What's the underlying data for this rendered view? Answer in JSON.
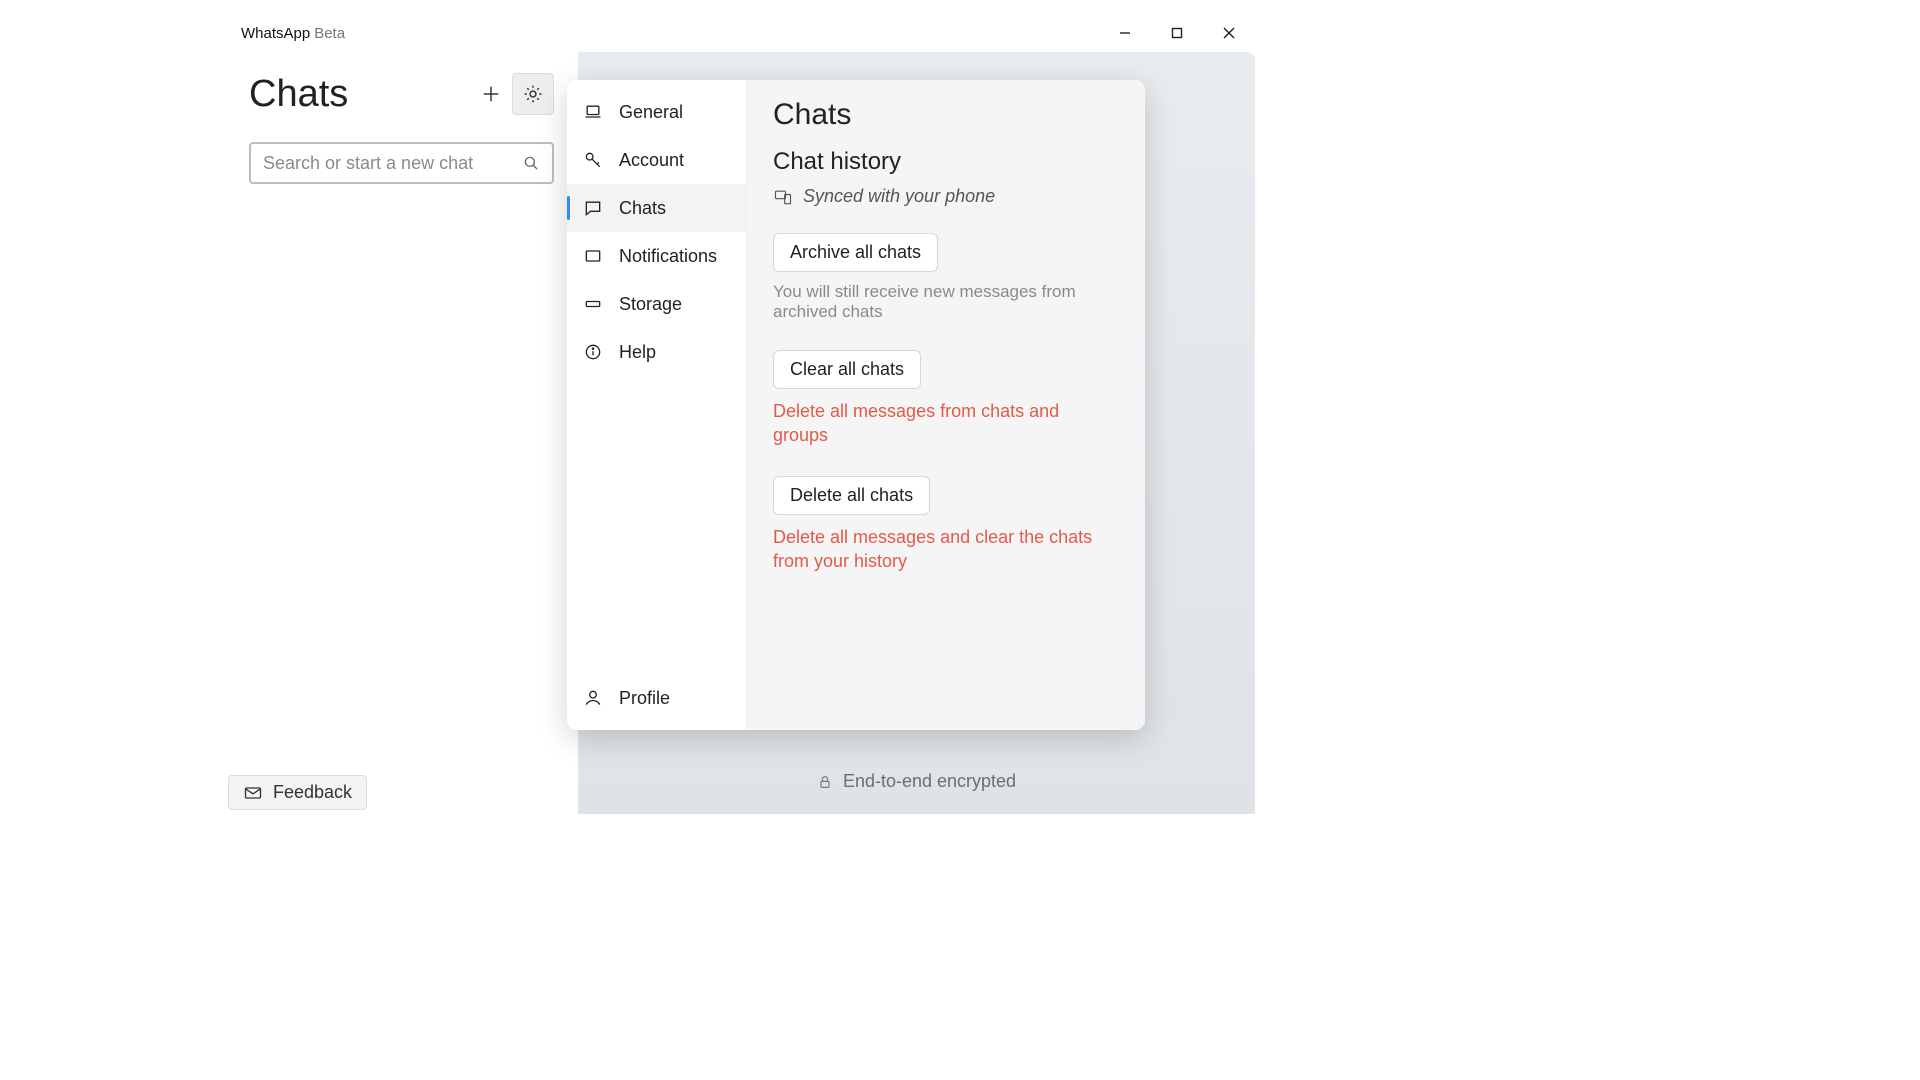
{
  "titlebar": {
    "app_name": "WhatsApp",
    "beta": "Beta"
  },
  "left": {
    "title": "Chats",
    "search_placeholder": "Search or start a new chat"
  },
  "settings": {
    "nav": {
      "general": "General",
      "account": "Account",
      "chats": "Chats",
      "notifications": "Notifications",
      "storage": "Storage",
      "help": "Help",
      "profile": "Profile"
    },
    "content": {
      "title": "Chats",
      "subtitle": "Chat history",
      "sync_text": "Synced with your phone",
      "archive_btn": "Archive all chats",
      "archive_hint": "You will still receive new messages from archived chats",
      "clear_btn": "Clear all chats",
      "clear_hint": "Delete all messages from chats and groups",
      "delete_btn": "Delete all chats",
      "delete_hint": "Delete all messages and clear the chats from your history"
    }
  },
  "footer": {
    "encrypted": "End-to-end encrypted"
  },
  "feedback": {
    "label": "Feedback"
  }
}
